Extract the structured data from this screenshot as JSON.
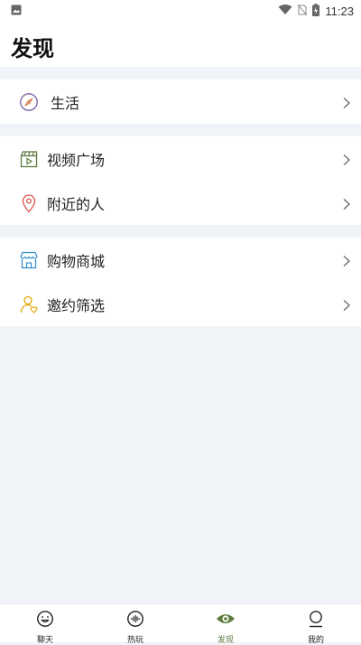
{
  "status_bar": {
    "time": "11:23"
  },
  "header": {
    "title": "发现"
  },
  "groups": [
    {
      "items": [
        {
          "label": "生活",
          "icon": "compass-icon"
        }
      ]
    },
    {
      "items": [
        {
          "label": "视频广场",
          "icon": "video-clapper-icon"
        },
        {
          "label": "附近的人",
          "icon": "location-pin-icon"
        }
      ]
    },
    {
      "items": [
        {
          "label": "购物商城",
          "icon": "store-icon"
        },
        {
          "label": "邀约筛选",
          "icon": "user-heart-icon"
        }
      ]
    }
  ],
  "tabs": [
    {
      "label": "聊天",
      "icon": "smile-chat-icon"
    },
    {
      "label": "热玩",
      "icon": "sound-wave-icon"
    },
    {
      "label": "发现",
      "icon": "eye-icon",
      "active": true
    },
    {
      "label": "我的",
      "icon": "user-icon"
    }
  ],
  "colors": {
    "active_tab": "#5d7a3e",
    "background": "#f0f4f9"
  }
}
